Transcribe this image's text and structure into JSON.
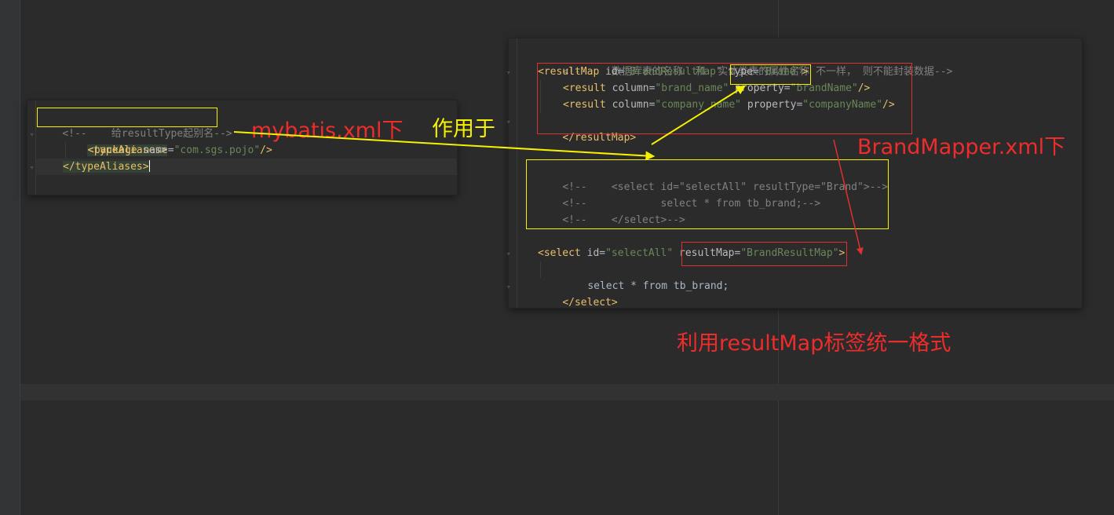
{
  "left_snippet": {
    "lines": [
      {
        "comment": "<!--    给resultType起别名-->"
      },
      {
        "open_tag": "<typeAliases>"
      },
      {
        "tag_open": "<package",
        "attr": "name",
        "eq": "=",
        "value": "\"com.sgs.pojo\"",
        "close": "/>"
      },
      {
        "close_tag": "</typeAliases>"
      }
    ]
  },
  "right_snippet": {
    "comment_line": "<!--    数据库表的名称  和  实体类表的属性名称 不一样， 则不能封装数据-->",
    "result_map": {
      "open_lt": "<",
      "tag": "resultMap",
      "id_attr": "id",
      "eq": "=",
      "id_value": "\"BrandResultMap\"",
      "type_attr": "type",
      "type_value": "\"Brand\"",
      "gt": ">",
      "results": [
        {
          "tag": "<result",
          "column_attr": "column",
          "column_value": "\"brand_name\"",
          "property_attr": "property",
          "property_value": "\"brandName\"",
          "close": "/>"
        },
        {
          "tag": "<result",
          "column_attr": "column",
          "column_value": "\"company_name\"",
          "property_attr": "property",
          "property_value": "\"companyName\"",
          "close": "/>"
        }
      ],
      "close_tag": "</resultMap>"
    },
    "commented_select": [
      "<!--    <select id=\"selectAll\" resultType=\"Brand\">-->",
      "<!--            select * from tb_brand;-->",
      "<!--    </select>-->"
    ],
    "select": {
      "open_lt": "<",
      "tag": "select",
      "id_attr": "id",
      "eq": "=",
      "id_value": "\"selectAll\"",
      "map_attr": "resultMap",
      "map_value": "\"BrandResultMap\"",
      "gt": ">",
      "body": "select * from tb_brand;",
      "close_tag": "</select>"
    }
  },
  "annotations": {
    "mybatis_label": "mybatis.xml下",
    "applies_to_label": "作用于",
    "brandmapper_label": "BrandMapper.xml下",
    "summary_label": "利用resultMap标签统一格式"
  },
  "colors": {
    "background": "#2b2b2b",
    "comment": "#808080",
    "tag": "#e8bf6a",
    "attribute": "#bababa",
    "string": "#6a8759",
    "annotation_red": "#ee2c2c",
    "annotation_yellow": "#f5f100"
  }
}
